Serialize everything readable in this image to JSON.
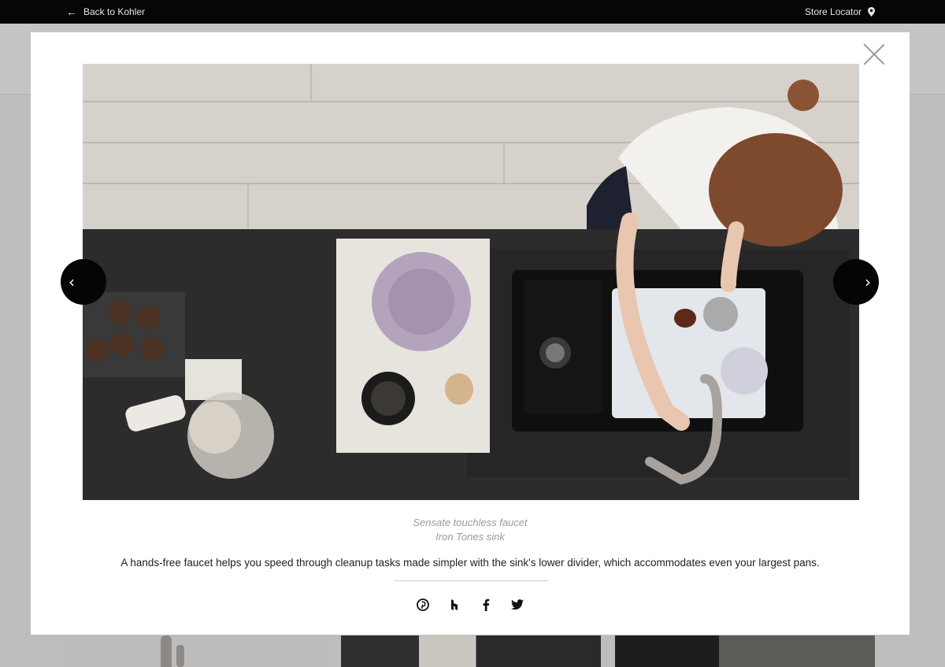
{
  "topbar": {
    "back_label": "Back to Kohler",
    "store_label": "Store Locator"
  },
  "modal": {
    "caption_line1": "Sensate touchless faucet",
    "caption_line2": "Iron Tones sink",
    "description": "A hands-free faucet helps you speed through cleanup tasks made simpler with the sink's lower divider, which accommodates even your largest pans.",
    "share_icons": [
      "pinterest-icon",
      "houzz-icon",
      "facebook-icon",
      "twitter-icon"
    ]
  },
  "colors": {
    "topbar": "#060606",
    "overlay": "#bdbdbd",
    "caption": "#9a9a9a"
  }
}
